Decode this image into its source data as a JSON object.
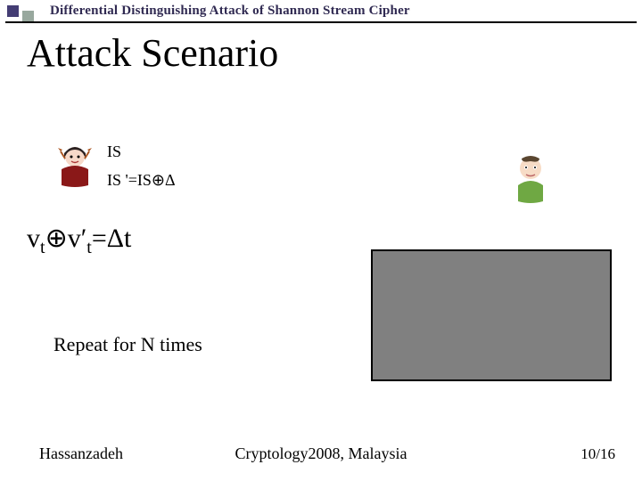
{
  "header": {
    "title": "Differential Distinguishing Attack of Shannon Stream Cipher"
  },
  "title": "Attack Scenario",
  "content": {
    "line1": "IS",
    "line2": "IS '=IS⊕Δ",
    "equation": "vₜ⊕v′ₜ=Δt",
    "repeat": "Repeat for N times"
  },
  "icons": {
    "attacker": "attacker-avatar-icon",
    "victim": "user-avatar-icon",
    "placeholder": "gray-box"
  },
  "footer": {
    "left": "Hassanzadeh",
    "center": "Cryptology2008, Malaysia",
    "right": "10/16"
  }
}
